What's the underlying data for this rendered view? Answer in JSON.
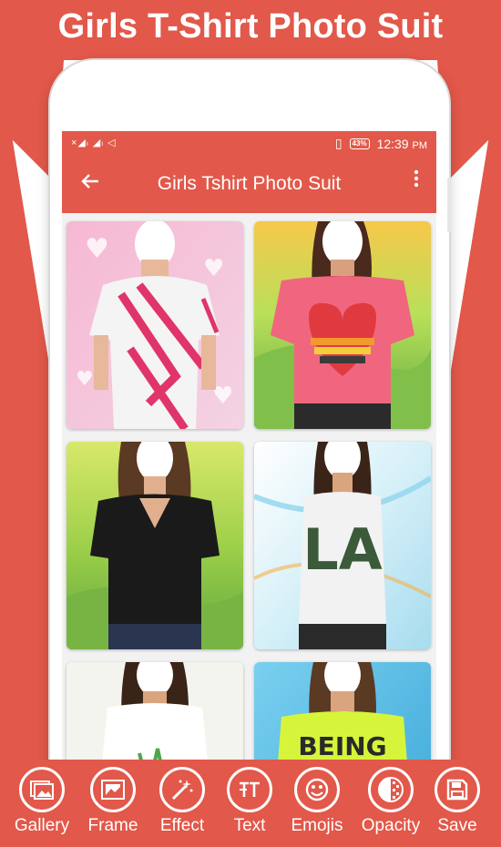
{
  "banner": {
    "title": "Girls T-Shirt Photo Suit"
  },
  "statusbar": {
    "battery": "43%",
    "time": "12:39",
    "ampm": "PM"
  },
  "appbar": {
    "title": "Girls Tshirt Photo Suit",
    "back_icon": "arrow-left-icon",
    "menu_icon": "more-vert-icon"
  },
  "frames": [
    {
      "shirt": "white tee with pink strokes",
      "bg": "pink hearts"
    },
    {
      "shirt": "pink off-shoulder tee with heart",
      "bg": "green landscape"
    },
    {
      "shirt": "black v-neck tee",
      "bg": "green landscape"
    },
    {
      "shirt": "white LA tank top",
      "bg": "light blue abstract"
    },
    {
      "shirt": "white tank top",
      "bg": "light"
    },
    {
      "shirt": "neon BEING tee",
      "bg": "blue"
    }
  ],
  "tools": [
    {
      "label": "Gallery",
      "icon": "gallery-icon"
    },
    {
      "label": "Frame",
      "icon": "frame-icon"
    },
    {
      "label": "Effect",
      "icon": "magic-wand-icon"
    },
    {
      "label": "Text",
      "icon": "text-icon"
    },
    {
      "label": "Emojis",
      "icon": "emoji-icon"
    },
    {
      "label": "Opacity",
      "icon": "opacity-icon"
    },
    {
      "label": "Save",
      "icon": "save-icon"
    }
  ],
  "colors": {
    "accent": "#e2584a",
    "white": "#ffffff"
  }
}
